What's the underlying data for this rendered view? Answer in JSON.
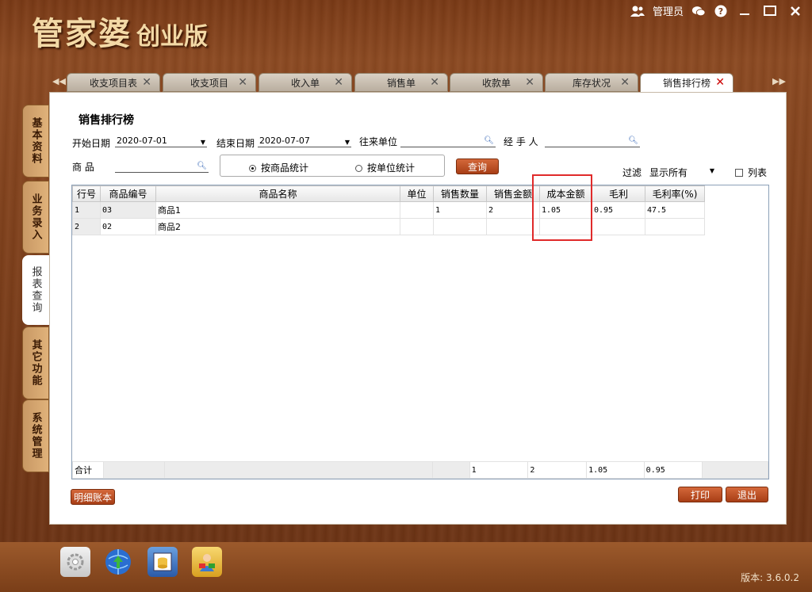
{
  "app": {
    "logo_main": "管家婆",
    "logo_sub": "创业版",
    "user_label": "管理员",
    "version": "版本: 3.6.0.2"
  },
  "tabs": [
    {
      "label": "收支项目表"
    },
    {
      "label": "收支项目"
    },
    {
      "label": "收入单"
    },
    {
      "label": "销售单"
    },
    {
      "label": "收款单"
    },
    {
      "label": "库存状况"
    },
    {
      "label": "销售排行榜"
    }
  ],
  "side_tabs": [
    {
      "label": "基本资料"
    },
    {
      "label": "业务录入"
    },
    {
      "label": "报表查询"
    },
    {
      "label": "其它功能"
    },
    {
      "label": "系统管理"
    }
  ],
  "panel": {
    "title": "销售排行榜",
    "start_date_label": "开始日期",
    "start_date": "2020-07-01",
    "end_date_label": "结束日期",
    "end_date": "2020-07-07",
    "partner_label": "往来单位",
    "handler_label": "经 手 人",
    "product_label": "商    品",
    "radio_by_product": "按商品统计",
    "radio_by_unit": "按单位统计",
    "query_button": "查询",
    "filter_label": "过滤",
    "filter_value": "显示所有",
    "list_checkbox": "列表",
    "detail_button": "明细账本",
    "print_button": "打印",
    "exit_button": "退出"
  },
  "table": {
    "headers": [
      "行号",
      "商品编号",
      "商品名称",
      "单位",
      "销售数量",
      "销售金额",
      "成本金额",
      "毛利",
      "毛利率(%)"
    ],
    "rows": [
      [
        "1",
        "03",
        "商品1",
        "",
        "1",
        "2",
        "1.05",
        "0.95",
        "47.5"
      ],
      [
        "2",
        "02",
        "商品2",
        "",
        "",
        "",
        "",
        "",
        ""
      ]
    ],
    "total": [
      "合计",
      "",
      "",
      "",
      "1",
      "2",
      "1.05",
      "0.95",
      ""
    ]
  }
}
